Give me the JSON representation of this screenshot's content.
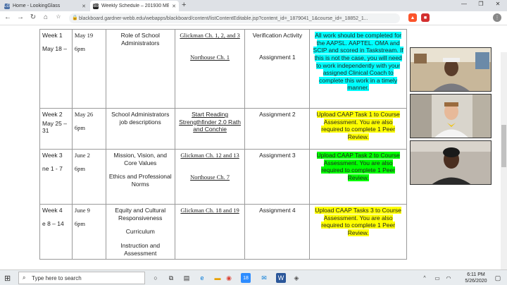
{
  "browser": {
    "tabs": [
      {
        "label": "Home - LookingGlass",
        "favicon": "LG"
      },
      {
        "label": "Weekly Schedule – 201930 MELSC",
        "favicon": "Bb"
      }
    ],
    "new_tab": "+",
    "url": "blackboard.gardner-webb.edu/webapps/blackboard/content/listContentEditable.jsp?content_id=_1879041_1&course_id=_18852_1...",
    "window_controls": {
      "minimize": "—",
      "maximize": "❐",
      "close": "✕"
    }
  },
  "schedule": {
    "rows": [
      {
        "week": "Week 1",
        "week_dates": "May 18 –",
        "date": "May 19",
        "time": "6pm",
        "topic": [
          "Role of School Administrators"
        ],
        "reading": [
          "Glickman Ch. 1, 2, and 3",
          "Northouse Ch. 1"
        ],
        "activity": [
          "Verification Activity",
          "Assignment 1"
        ],
        "notes": "All work should be completed for the AAPSL. AAPTEL. OMA and SCIP and scored in Taskstream.  If this is not the case, you will need to work independently with your assigned Clinical Coach to complete this work in a timely manner."
      },
      {
        "week": "Week 2",
        "week_dates": "May 25 – 31",
        "date": "May 26",
        "time": "6pm",
        "topic": [
          "School Administrators job descriptions"
        ],
        "reading": [
          "Start Reading Strengthfinder 2.0 Rath and Conchie"
        ],
        "activity": [
          "Assignment 2"
        ],
        "notes": "Upload CAAP Task 1 to Course Assessment.  You are also required to complete 1 Peer Review."
      },
      {
        "week": "Week 3",
        "week_dates": "ne 1 - 7",
        "date": "June 2",
        "time": "6pm",
        "topic": [
          "Mission, Vision, and Core Values",
          "Ethics and Professional Norms"
        ],
        "reading": [
          "Glickman Ch. 12 and 13",
          "Northouse Ch. 7"
        ],
        "activity": [
          "Assignment 3"
        ],
        "notes": "Upload CAAP Task 2  to Course Assessment.  You are also required to complete 1 Peer Review."
      },
      {
        "week": "Week 4",
        "week_dates": "e 8 – 14",
        "date": "June 9",
        "time": "6pm",
        "topic": [
          "Equity and Cultural Responsiveness",
          "Curriculum",
          "Instruction and Assessment"
        ],
        "reading": [
          "Glickman Ch. 18 and 19"
        ],
        "activity": [
          "Assignment 4"
        ],
        "notes": "Upload CAAP Tasks 3  to Course Assessment.  You are also required to complete 1 Peer Review."
      }
    ]
  },
  "taskbar": {
    "search_placeholder": "Type here to search",
    "time": "6:11 PM",
    "date": "5/26/2020",
    "badge": "18"
  },
  "colors": {
    "highlight_cyan": "#00ffff",
    "highlight_yellow": "#ffff00",
    "highlight_green": "#00ff00"
  }
}
